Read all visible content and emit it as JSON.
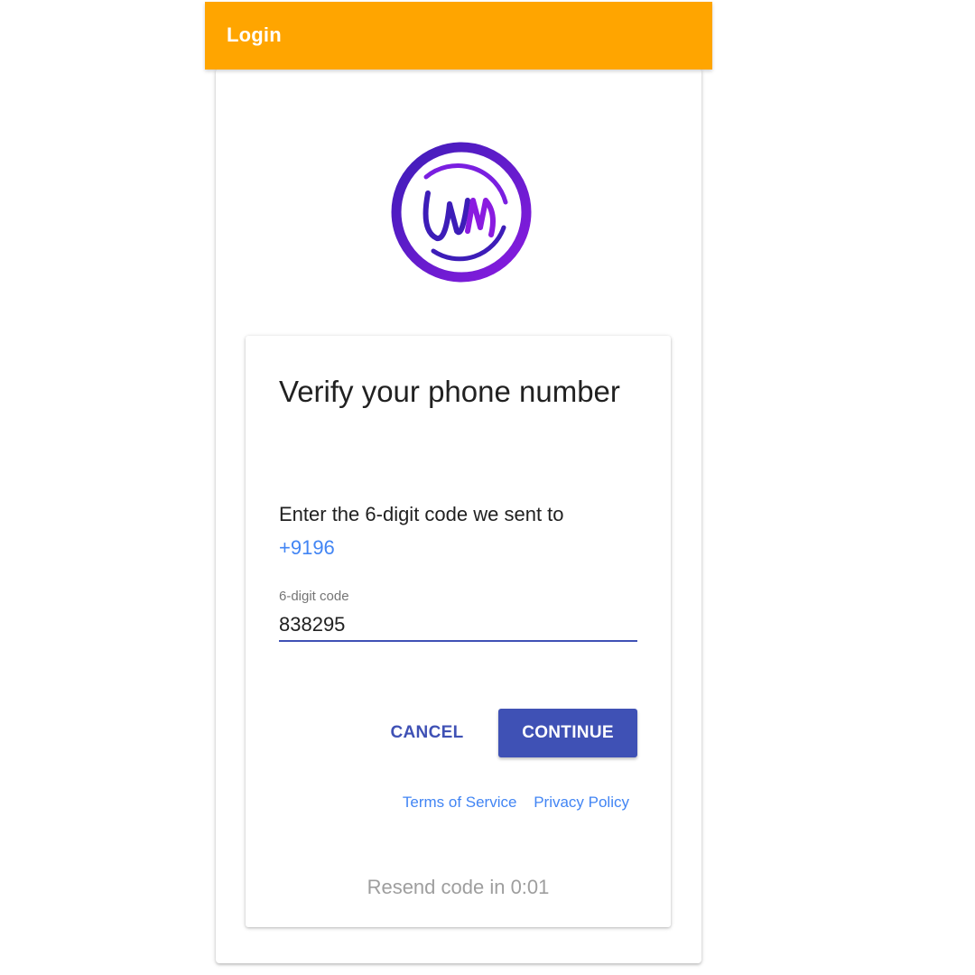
{
  "app_bar": {
    "title": "Login",
    "color": "#FFA500"
  },
  "logo": {
    "icon": "wm-logo-icon",
    "text": "WM",
    "colors": [
      "#3D1DB8",
      "#8A1BE0"
    ]
  },
  "verify": {
    "title": "Verify your phone number",
    "instruction": "Enter the 6-digit code we sent to",
    "phone_number": "+9196"
  },
  "code_field": {
    "label": "6-digit code",
    "value": "838295"
  },
  "actions": {
    "cancel_label": "CANCEL",
    "continue_label": "CONTINUE",
    "primary_color": "#3F51B5"
  },
  "links": {
    "terms": "Terms of Service",
    "privacy": "Privacy Policy"
  },
  "resend": {
    "text": "Resend code in 0:01"
  }
}
